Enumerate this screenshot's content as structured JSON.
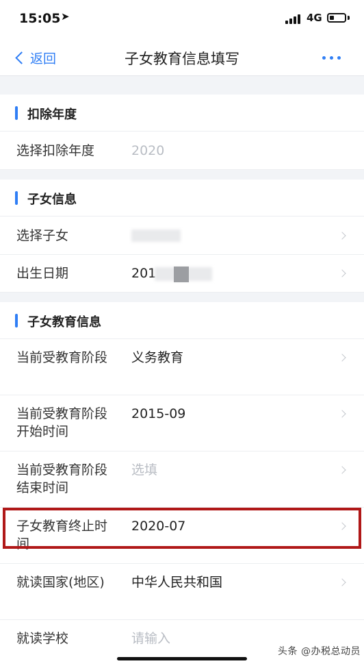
{
  "status_bar": {
    "time": "15:05",
    "network": "4G"
  },
  "nav": {
    "back_label": "返回",
    "title": "子女教育信息填写"
  },
  "sections": {
    "deduction_year": {
      "title": "扣除年度",
      "year_label": "选择扣除年度",
      "year_value": "2020"
    },
    "child_info": {
      "title": "子女信息",
      "child_label": "选择子女",
      "birth_label": "出生日期",
      "birth_value": "201"
    },
    "education_info": {
      "title": "子女教育信息",
      "stage_label": "当前受教育阶段",
      "stage_value": "义务教育",
      "start_label": "当前受教育阶段开始时间",
      "start_value": "2015-09",
      "end_label": "当前受教育阶段结束时间",
      "end_placeholder": "选填",
      "termination_label": "子女教育终止时间",
      "termination_value": "2020-07",
      "country_label": "就读国家(地区)",
      "country_value": "中华人民共和国",
      "school_label": "就读学校",
      "school_placeholder": "请输入"
    }
  },
  "watermark": "头条 @办税总动员",
  "colors": {
    "accent": "#2f7ef5",
    "highlight": "#b01818"
  }
}
